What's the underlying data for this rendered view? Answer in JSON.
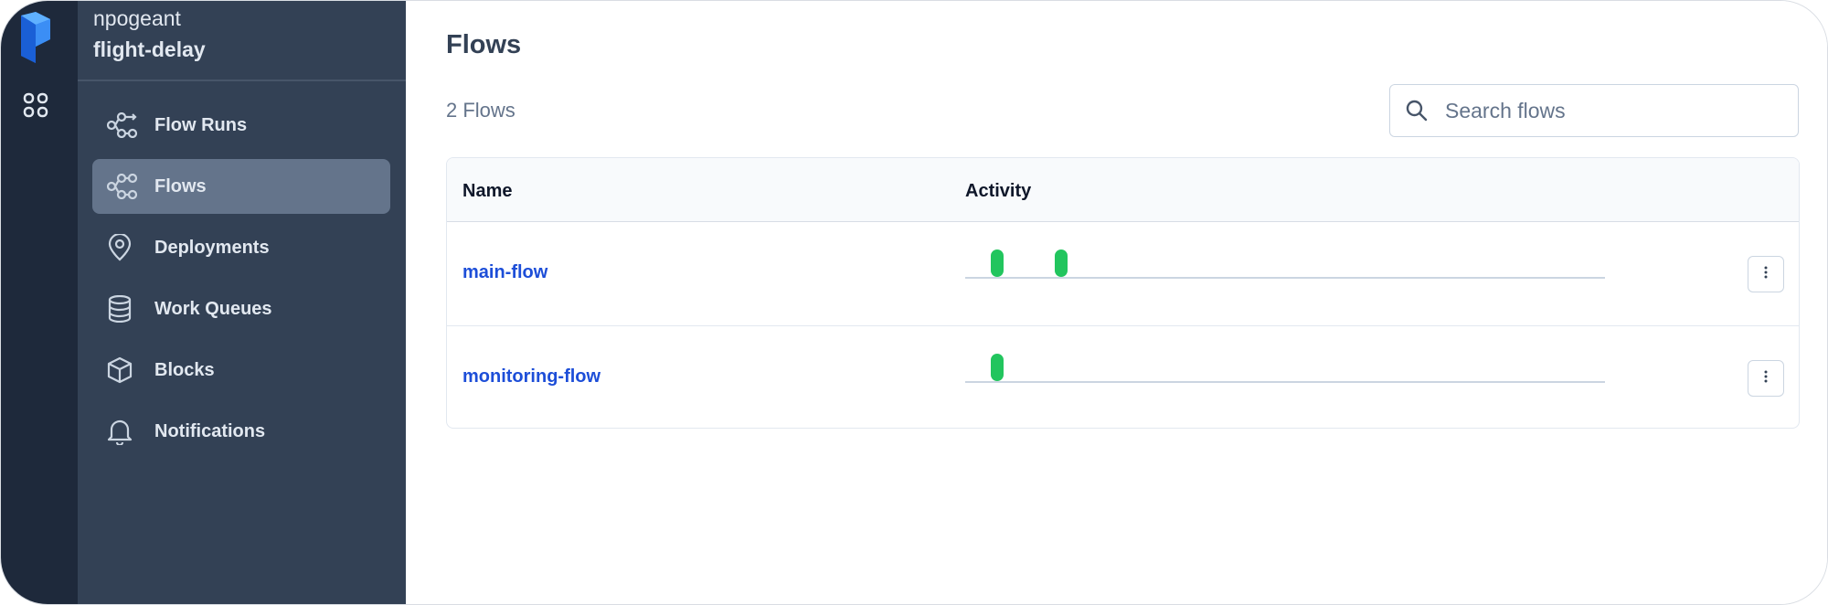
{
  "workspace": {
    "org": "npogeant",
    "name": "flight-delay"
  },
  "sidebar": {
    "items": [
      {
        "label": "Flow Runs",
        "icon": "flow-runs-icon",
        "active": false
      },
      {
        "label": "Flows",
        "icon": "flows-icon",
        "active": true
      },
      {
        "label": "Deployments",
        "icon": "map-pin-icon",
        "active": false
      },
      {
        "label": "Work Queues",
        "icon": "database-icon",
        "active": false
      },
      {
        "label": "Blocks",
        "icon": "cube-icon",
        "active": false
      },
      {
        "label": "Notifications",
        "icon": "bell-icon",
        "active": false
      }
    ]
  },
  "page": {
    "title": "Flows",
    "count": "2 Flows",
    "search": {
      "placeholder": "Search flows"
    }
  },
  "table": {
    "headers": {
      "name": "Name",
      "activity": "Activity"
    },
    "rows": [
      {
        "name": "main-flow",
        "activity_runs": 2
      },
      {
        "name": "monitoring-flow",
        "activity_runs": 1
      }
    ]
  },
  "colors": {
    "rail": "#1e293b",
    "sidebar": "#334155",
    "active_item": "#64748b",
    "link": "#1d4ed8",
    "run_completed": "#22c55e",
    "logo": "#2f80ed"
  }
}
